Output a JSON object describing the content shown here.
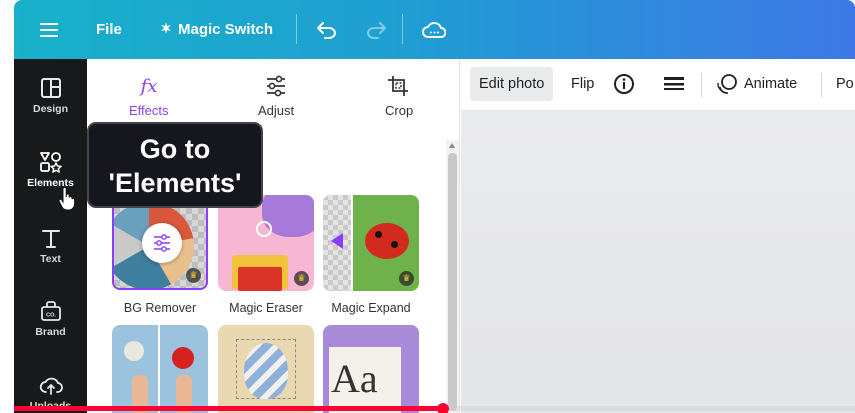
{
  "topbar": {
    "menu_icon": "hamburger-icon",
    "file_label": "File",
    "magic_switch_label": "Magic Switch",
    "magic_icon": "magic-wand-icon",
    "undo_icon": "undo-icon",
    "redo_icon": "redo-icon",
    "cloud_icon": "cloud-sync-icon"
  },
  "rail": {
    "items": [
      {
        "label": "Design",
        "icon": "layout-icon"
      },
      {
        "label": "Elements",
        "icon": "shapes-icon",
        "active": true
      },
      {
        "label": "Text",
        "icon": "text-icon"
      },
      {
        "label": "Brand",
        "icon": "brand-icon"
      },
      {
        "label": "Uploads",
        "icon": "upload-cloud-icon"
      }
    ]
  },
  "panel": {
    "tabs": [
      {
        "label": "Effects",
        "icon": "fx-icon",
        "active": true
      },
      {
        "label": "Adjust",
        "icon": "sliders-icon"
      },
      {
        "label": "Crop",
        "icon": "crop-icon"
      }
    ],
    "tools": [
      {
        "label": "BG Remover"
      },
      {
        "label": "Magic Eraser"
      },
      {
        "label": "Magic Expand"
      },
      {
        "label": ""
      },
      {
        "label": ""
      },
      {
        "label": ""
      }
    ]
  },
  "tooltip": {
    "line1": "Go to",
    "line2": "'Elements'"
  },
  "context_toolbar": {
    "edit_photo": "Edit photo",
    "flip": "Flip",
    "info_icon": "info-icon",
    "lines_icon": "border-style-icon",
    "animate": "Animate",
    "animate_icon": "animate-icon",
    "position_partial": "Po"
  },
  "video": {
    "progress": 0.51
  },
  "colors": {
    "accent": "#8b3dff",
    "topbar_start": "#18b1c9",
    "topbar_end": "#3d78e6",
    "rail_bg": "#18191b",
    "progress": "#ff0033"
  }
}
